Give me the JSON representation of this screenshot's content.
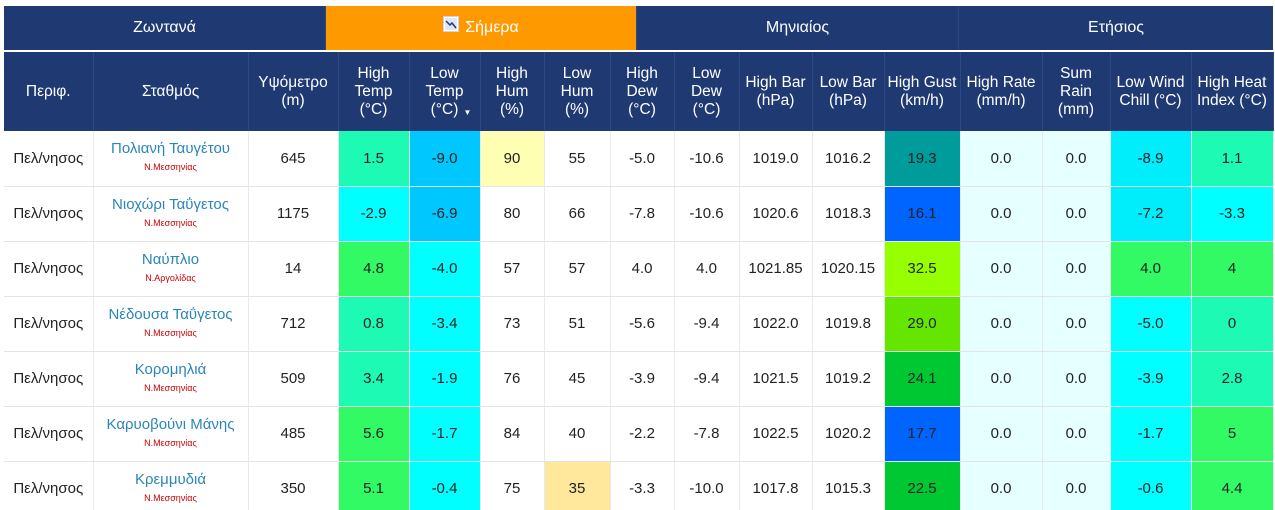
{
  "tabs": [
    {
      "label": "Ζωντανά",
      "active": false
    },
    {
      "label": "Σήμερα",
      "active": true,
      "icon": "chart-icon"
    },
    {
      "label": "Μηνιαίος",
      "active": false
    },
    {
      "label": "Ετήσιος",
      "active": false
    }
  ],
  "columns": [
    [
      "Περιφ."
    ],
    [
      "Σταθμός"
    ],
    [
      "Υψόμετρο",
      "(m)"
    ],
    [
      "High",
      "Temp",
      "(°C)"
    ],
    [
      "Low",
      "Temp",
      "(°C)"
    ],
    [
      "High",
      "Hum",
      "(%)"
    ],
    [
      "Low",
      "Hum",
      "(%)"
    ],
    [
      "High",
      "Dew",
      "(°C)"
    ],
    [
      "Low",
      "Dew",
      "(°C)"
    ],
    [
      "High Bar",
      "(hPa)"
    ],
    [
      "Low Bar",
      "(hPa)"
    ],
    [
      "High Gust",
      "(km/h)"
    ],
    [
      "High Rate",
      "(mm/h)"
    ],
    [
      "Sum",
      "Rain",
      "(mm)"
    ],
    [
      "Low Wind",
      "Chill (°C)"
    ],
    [
      "High Heat",
      "Index (°C)"
    ]
  ],
  "sort": {
    "column_index": 4,
    "direction": "descending",
    "indicator": "▼"
  },
  "rows": [
    {
      "region": "Πελ/νησος",
      "station": "Πολιανή Ταυγέτου",
      "prefecture": "Ν.Μεσσηνίας",
      "cells": [
        "645",
        "1.5",
        "-9.0",
        "90",
        "55",
        "-5.0",
        "-10.6",
        "1019.0",
        "1016.2",
        "19.3",
        "0.0",
        "0.0",
        "-8.9",
        "1.1"
      ],
      "colors": [
        "#ffffff",
        "#1dfab3",
        "#00c8ff",
        "#ffffb3",
        "#ffffff",
        "#ffffff",
        "#ffffff",
        "#ffffff",
        "#ffffff",
        "#009b9b",
        "#e6ffff",
        "#e6ffff",
        "#00eefb",
        "#1dfab3"
      ]
    },
    {
      "region": "Πελ/νησος",
      "station": "Νιοχώρι Ταΰγετος",
      "prefecture": "Ν.Μεσσηνίας",
      "cells": [
        "1175",
        "-2.9",
        "-6.9",
        "80",
        "66",
        "-7.8",
        "-10.6",
        "1020.6",
        "1018.3",
        "16.1",
        "0.0",
        "0.0",
        "-7.2",
        "-3.3"
      ],
      "colors": [
        "#ffffff",
        "#00ffff",
        "#00c8ff",
        "#ffffff",
        "#ffffff",
        "#ffffff",
        "#ffffff",
        "#ffffff",
        "#ffffff",
        "#0064ff",
        "#e6ffff",
        "#e6ffff",
        "#00eefb",
        "#00ffff"
      ]
    },
    {
      "region": "Πελ/νησος",
      "station": "Ναύπλιο",
      "prefecture": "Ν.Αργολίδας",
      "cells": [
        "14",
        "4.8",
        "-4.0",
        "57",
        "57",
        "4.0",
        "4.0",
        "1021.85",
        "1020.15",
        "32.5",
        "0.0",
        "0.0",
        "4.0",
        "4"
      ],
      "colors": [
        "#ffffff",
        "#32fa64",
        "#00ffff",
        "#ffffff",
        "#ffffff",
        "#ffffff",
        "#ffffff",
        "#ffffff",
        "#ffffff",
        "#96ff00",
        "#e6ffff",
        "#e6ffff",
        "#32fa64",
        "#32fa64"
      ]
    },
    {
      "region": "Πελ/νησος",
      "station": "Νέδουσα Ταΰγετος",
      "prefecture": "Ν.Μεσσηνίας",
      "cells": [
        "712",
        "0.8",
        "-3.4",
        "73",
        "51",
        "-5.6",
        "-9.4",
        "1022.0",
        "1019.8",
        "29.0",
        "0.0",
        "0.0",
        "-5.0",
        "0"
      ],
      "colors": [
        "#ffffff",
        "#1dfab3",
        "#00ffff",
        "#ffffff",
        "#ffffff",
        "#ffffff",
        "#ffffff",
        "#ffffff",
        "#ffffff",
        "#64e600",
        "#e6ffff",
        "#e6ffff",
        "#00ffff",
        "#1dfab3"
      ]
    },
    {
      "region": "Πελ/νησος",
      "station": "Κορομηλιά",
      "prefecture": "Ν.Μεσσηνίας",
      "cells": [
        "509",
        "3.4",
        "-1.9",
        "76",
        "45",
        "-3.9",
        "-9.4",
        "1021.5",
        "1019.2",
        "24.1",
        "0.0",
        "0.0",
        "-3.9",
        "2.8"
      ],
      "colors": [
        "#ffffff",
        "#1dfab3",
        "#00ffff",
        "#ffffff",
        "#ffffff",
        "#ffffff",
        "#ffffff",
        "#ffffff",
        "#ffffff",
        "#00c832",
        "#e6ffff",
        "#e6ffff",
        "#00ffff",
        "#1dfab3"
      ]
    },
    {
      "region": "Πελ/νησος",
      "station": "Καρυοβούνι Μάνης",
      "prefecture": "Ν.Μεσσηνίας",
      "cells": [
        "485",
        "5.6",
        "-1.7",
        "84",
        "40",
        "-2.2",
        "-7.8",
        "1022.5",
        "1020.2",
        "17.7",
        "0.0",
        "0.0",
        "-1.7",
        "5"
      ],
      "colors": [
        "#ffffff",
        "#32fa64",
        "#00ffff",
        "#ffffff",
        "#ffffff",
        "#ffffff",
        "#ffffff",
        "#ffffff",
        "#ffffff",
        "#0064ff",
        "#e6ffff",
        "#e6ffff",
        "#00ffff",
        "#32fa64"
      ]
    },
    {
      "region": "Πελ/νησος",
      "station": "Κρεμμυδιά",
      "prefecture": "Ν.Μεσσηνίας",
      "cells": [
        "350",
        "5.1",
        "-0.4",
        "75",
        "35",
        "-3.3",
        "-10.0",
        "1017.8",
        "1015.3",
        "22.5",
        "0.0",
        "0.0",
        "-0.6",
        "4.4"
      ],
      "colors": [
        "#ffffff",
        "#32fa64",
        "#00ffff",
        "#ffffff",
        "#ffe79b",
        "#ffffff",
        "#ffffff",
        "#ffffff",
        "#ffffff",
        "#00c832",
        "#e6ffff",
        "#e6ffff",
        "#00ffff",
        "#32fa64"
      ]
    }
  ]
}
